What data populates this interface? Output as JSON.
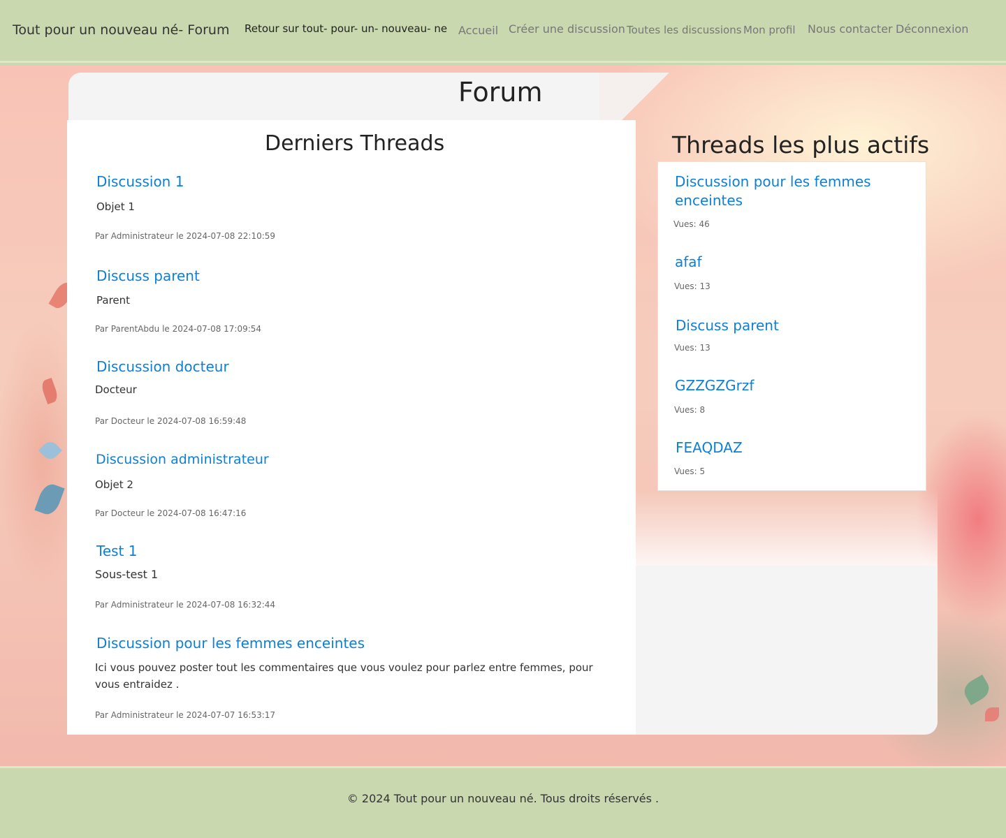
{
  "navbar": {
    "brand": "Tout pour un nouveau né- Forum",
    "links": [
      {
        "label": "Retour sur tout- pour- un- nouveau- ne"
      },
      {
        "label": "Accueil"
      },
      {
        "label": "Créer une discussion"
      },
      {
        "label": "Toutes les discussions"
      },
      {
        "label": "Mon profil"
      },
      {
        "label": "Nous contacter"
      },
      {
        "label": "Déconnexion"
      }
    ]
  },
  "page": {
    "title": "Forum"
  },
  "latest": {
    "heading": "Derniers Threads",
    "threads": [
      {
        "title": "Discussion 1",
        "subject": "Objet 1",
        "meta": "Par Administrateur le 2024-07-08 22:10:59"
      },
      {
        "title": "Discuss parent",
        "subject": "Parent",
        "meta": "Par ParentAbdu le 2024-07-08 17:09:54"
      },
      {
        "title": "Discussion docteur",
        "subject": "Docteur",
        "meta": "Par Docteur le 2024-07-08 16:59:48"
      },
      {
        "title": "Discussion administrateur",
        "subject": "Objet 2",
        "meta": "Par Docteur le 2024-07-08 16:47:16"
      },
      {
        "title": "Test 1",
        "subject": "Sous-test 1",
        "meta": "Par Administrateur le 2024-07-08 16:32:44"
      },
      {
        "title": "Discussion pour les femmes enceintes",
        "subject": "Ici vous pouvez poster tout les commentaires que vous voulez pour parlez entre femmes, pour vous entraidez .",
        "meta": "Par Administrateur le 2024-07-07 16:53:17"
      }
    ]
  },
  "active": {
    "heading": "Threads les plus actifs",
    "threads": [
      {
        "title": "Discussion pour les femmes enceintes",
        "views": "Vues: 46"
      },
      {
        "title": "afaf",
        "views": "Vues: 13"
      },
      {
        "title": "Discuss parent",
        "views": "Vues: 13"
      },
      {
        "title": "GZZGZGrzf",
        "views": "Vues: 8"
      },
      {
        "title": "FEAQDAZ",
        "views": "Vues: 5"
      }
    ]
  },
  "footer": {
    "text": "© 2024 Tout pour un nouveau né. Tous droits réservés ."
  },
  "colors": {
    "header_bg": "#c9d8ae",
    "link": "#0d7fd9",
    "panel": "#ffffff"
  }
}
